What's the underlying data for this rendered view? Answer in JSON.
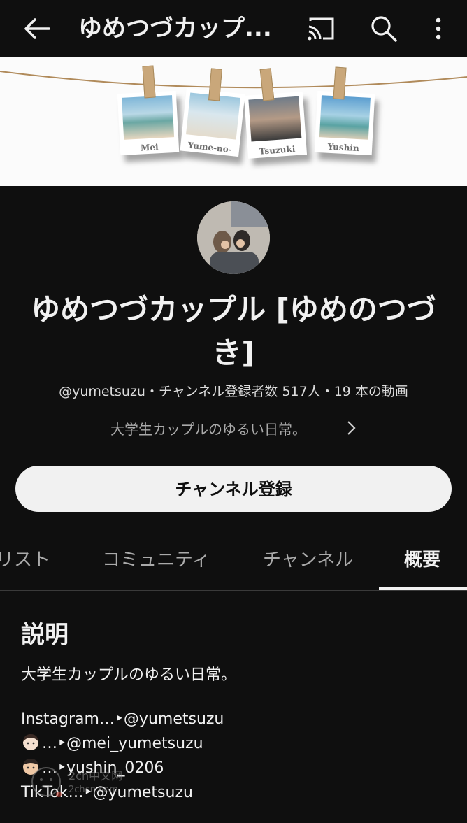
{
  "app_bar": {
    "title": "ゆめつづカップ...",
    "icons": [
      "back-arrow-icon",
      "cast-icon",
      "search-icon",
      "more-vert-icon"
    ]
  },
  "banner": {
    "captions": [
      "Mei",
      "Yume-no-",
      "Tsuzuki",
      "Yushin"
    ]
  },
  "channel": {
    "name": "ゆめつづカップル [ゆめのつづき]",
    "meta": "@yumetsuzu・チャンネル登録者数 517人・19 本の動画",
    "short_description": "大学生カップルのゆるい日常。",
    "subscribe_label": "チャンネル登録"
  },
  "tabs": [
    {
      "label": "リスト",
      "active": false
    },
    {
      "label": "コミュニティ",
      "active": false
    },
    {
      "label": "チャンネル",
      "active": false
    },
    {
      "label": "概要",
      "active": true
    }
  ],
  "about": {
    "heading": "説明",
    "description": "大学生カップルのゆるい日常。",
    "links": [
      {
        "prefix": "Instagram",
        "arrow": "…‣",
        "handle": "@yumetsuzu"
      },
      {
        "emoji": "girl-face-icon",
        "arrow": "…‣",
        "handle": "@mei_yumetsuzu"
      },
      {
        "emoji": "boy-face-icon",
        "arrow": "…‣",
        "handle": "yushin_0206"
      },
      {
        "prefix": "TikTok",
        "arrow": "…‣",
        "handle": "@yumetsuzu"
      }
    ]
  },
  "watermark": {
    "line1": "2ch中文网",
    "line2": "2chcn.com"
  },
  "colors": {
    "background": "#0f0f0f",
    "text": "#f1f1f1",
    "secondary_text": "#aaaaaa",
    "button_bg": "#f1f1f1"
  }
}
